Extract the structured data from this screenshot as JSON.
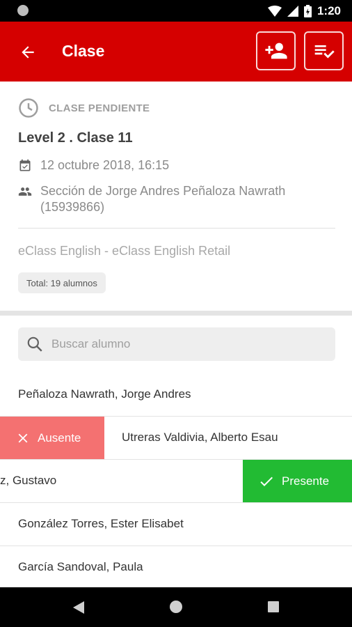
{
  "status_bar": {
    "time": "1:20"
  },
  "app_bar": {
    "title": "Clase",
    "icons": {
      "back": "arrow-left-icon",
      "add": "person-add-icon",
      "list": "playlist-check-icon"
    }
  },
  "class_info": {
    "status_label": "CLASE PENDIENTE",
    "title": "Level 2 . Clase 11",
    "date": "12 octubre 2018, 16:15",
    "section_line1": "Sección de Jorge Andres Peñaloza Nawrath",
    "section_line2": "(15939866)",
    "course": "eClass English - eClass English Retail",
    "total": "Total: 19 alumnos"
  },
  "search": {
    "placeholder": "Buscar alumno",
    "value": ""
  },
  "students": [
    {
      "name": "Peñaloza Nawrath, Jorge Andres"
    },
    {
      "name": "Utreras Valdivia, Alberto Esau",
      "swipe_action": "Ausente"
    },
    {
      "name": "z, Gustavo",
      "swipe_action": "Presente"
    },
    {
      "name": "González Torres, Ester Elisabet"
    },
    {
      "name": "García  Sandoval, Paula"
    }
  ],
  "colors": {
    "primary": "#d50000",
    "absent": "#f47171",
    "present": "#22bb33"
  }
}
